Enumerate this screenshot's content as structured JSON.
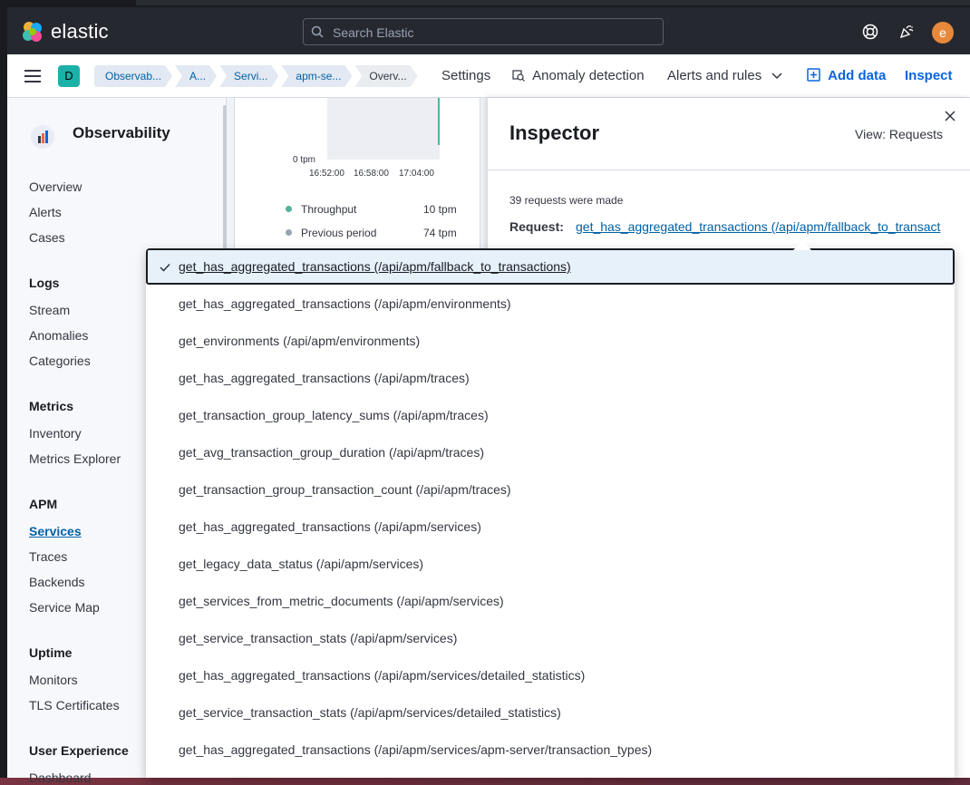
{
  "header": {
    "brand": "elastic",
    "search_placeholder": "Search Elastic",
    "avatar_letter": "e",
    "icons": [
      "help-icon",
      "newsfeed-icon"
    ]
  },
  "navbar": {
    "space_letter": "D",
    "breadcrumbs": [
      "Observab...",
      "A...",
      "Servi...",
      "apm-se...",
      "Overv..."
    ],
    "settings": "Settings",
    "anomaly_detection": "Anomaly detection",
    "alerts_and_rules": "Alerts and rules",
    "add_data": "Add data",
    "inspect": "Inspect"
  },
  "sidebar": {
    "title": "Observability",
    "items": [
      "Overview",
      "Alerts",
      "Cases"
    ],
    "sections": [
      {
        "heading": "Logs",
        "items": [
          "Stream",
          "Anomalies",
          "Categories"
        ]
      },
      {
        "heading": "Metrics",
        "items": [
          "Inventory",
          "Metrics Explorer"
        ]
      },
      {
        "heading": "APM",
        "items": [
          "Services",
          "Traces",
          "Backends",
          "Service Map"
        ]
      },
      {
        "heading": "Uptime",
        "items": [
          "Monitors",
          "TLS Certificates"
        ]
      },
      {
        "heading": "User Experience",
        "items": [
          "Dashboard"
        ]
      }
    ],
    "active_item": "Services"
  },
  "chart": {
    "zero_label": "0 tpm",
    "ticks": [
      "16:52:00",
      "16:58:00",
      "17:04:00"
    ],
    "legend": [
      {
        "name": "Throughput",
        "value": "10 tpm",
        "color": "#54b399"
      },
      {
        "name": "Previous period",
        "value": "74 tpm",
        "color": "#98a2b3"
      }
    ]
  },
  "inspector": {
    "title": "Inspector",
    "view": "View: Requests",
    "count_text": "39 requests were made",
    "request_label": "Request:",
    "request_value": "get_has_aggregated_transactions (/api/apm/fallback_to_transact",
    "selected_index": 0,
    "options": [
      "get_has_aggregated_transactions (/api/apm/fallback_to_transactions)",
      "get_has_aggregated_transactions (/api/apm/environments)",
      "get_environments (/api/apm/environments)",
      "get_has_aggregated_transactions (/api/apm/traces)",
      "get_transaction_group_latency_sums (/api/apm/traces)",
      "get_avg_transaction_group_duration (/api/apm/traces)",
      "get_transaction_group_transaction_count (/api/apm/traces)",
      "get_has_aggregated_transactions (/api/apm/services)",
      "get_legacy_data_status (/api/apm/services)",
      "get_services_from_metric_documents (/api/apm/services)",
      "get_service_transaction_stats (/api/apm/services)",
      "get_has_aggregated_transactions (/api/apm/services/detailed_statistics)",
      "get_service_transaction_stats (/api/apm/services/detailed_statistics)",
      "get_has_aggregated_transactions (/api/apm/services/apm-server/transaction_types)"
    ]
  },
  "colors": {
    "header_bg": "#25282f",
    "link": "#0061a6",
    "accent_blue": "#0b64dd",
    "selected_bg": "#e6f1fa"
  }
}
